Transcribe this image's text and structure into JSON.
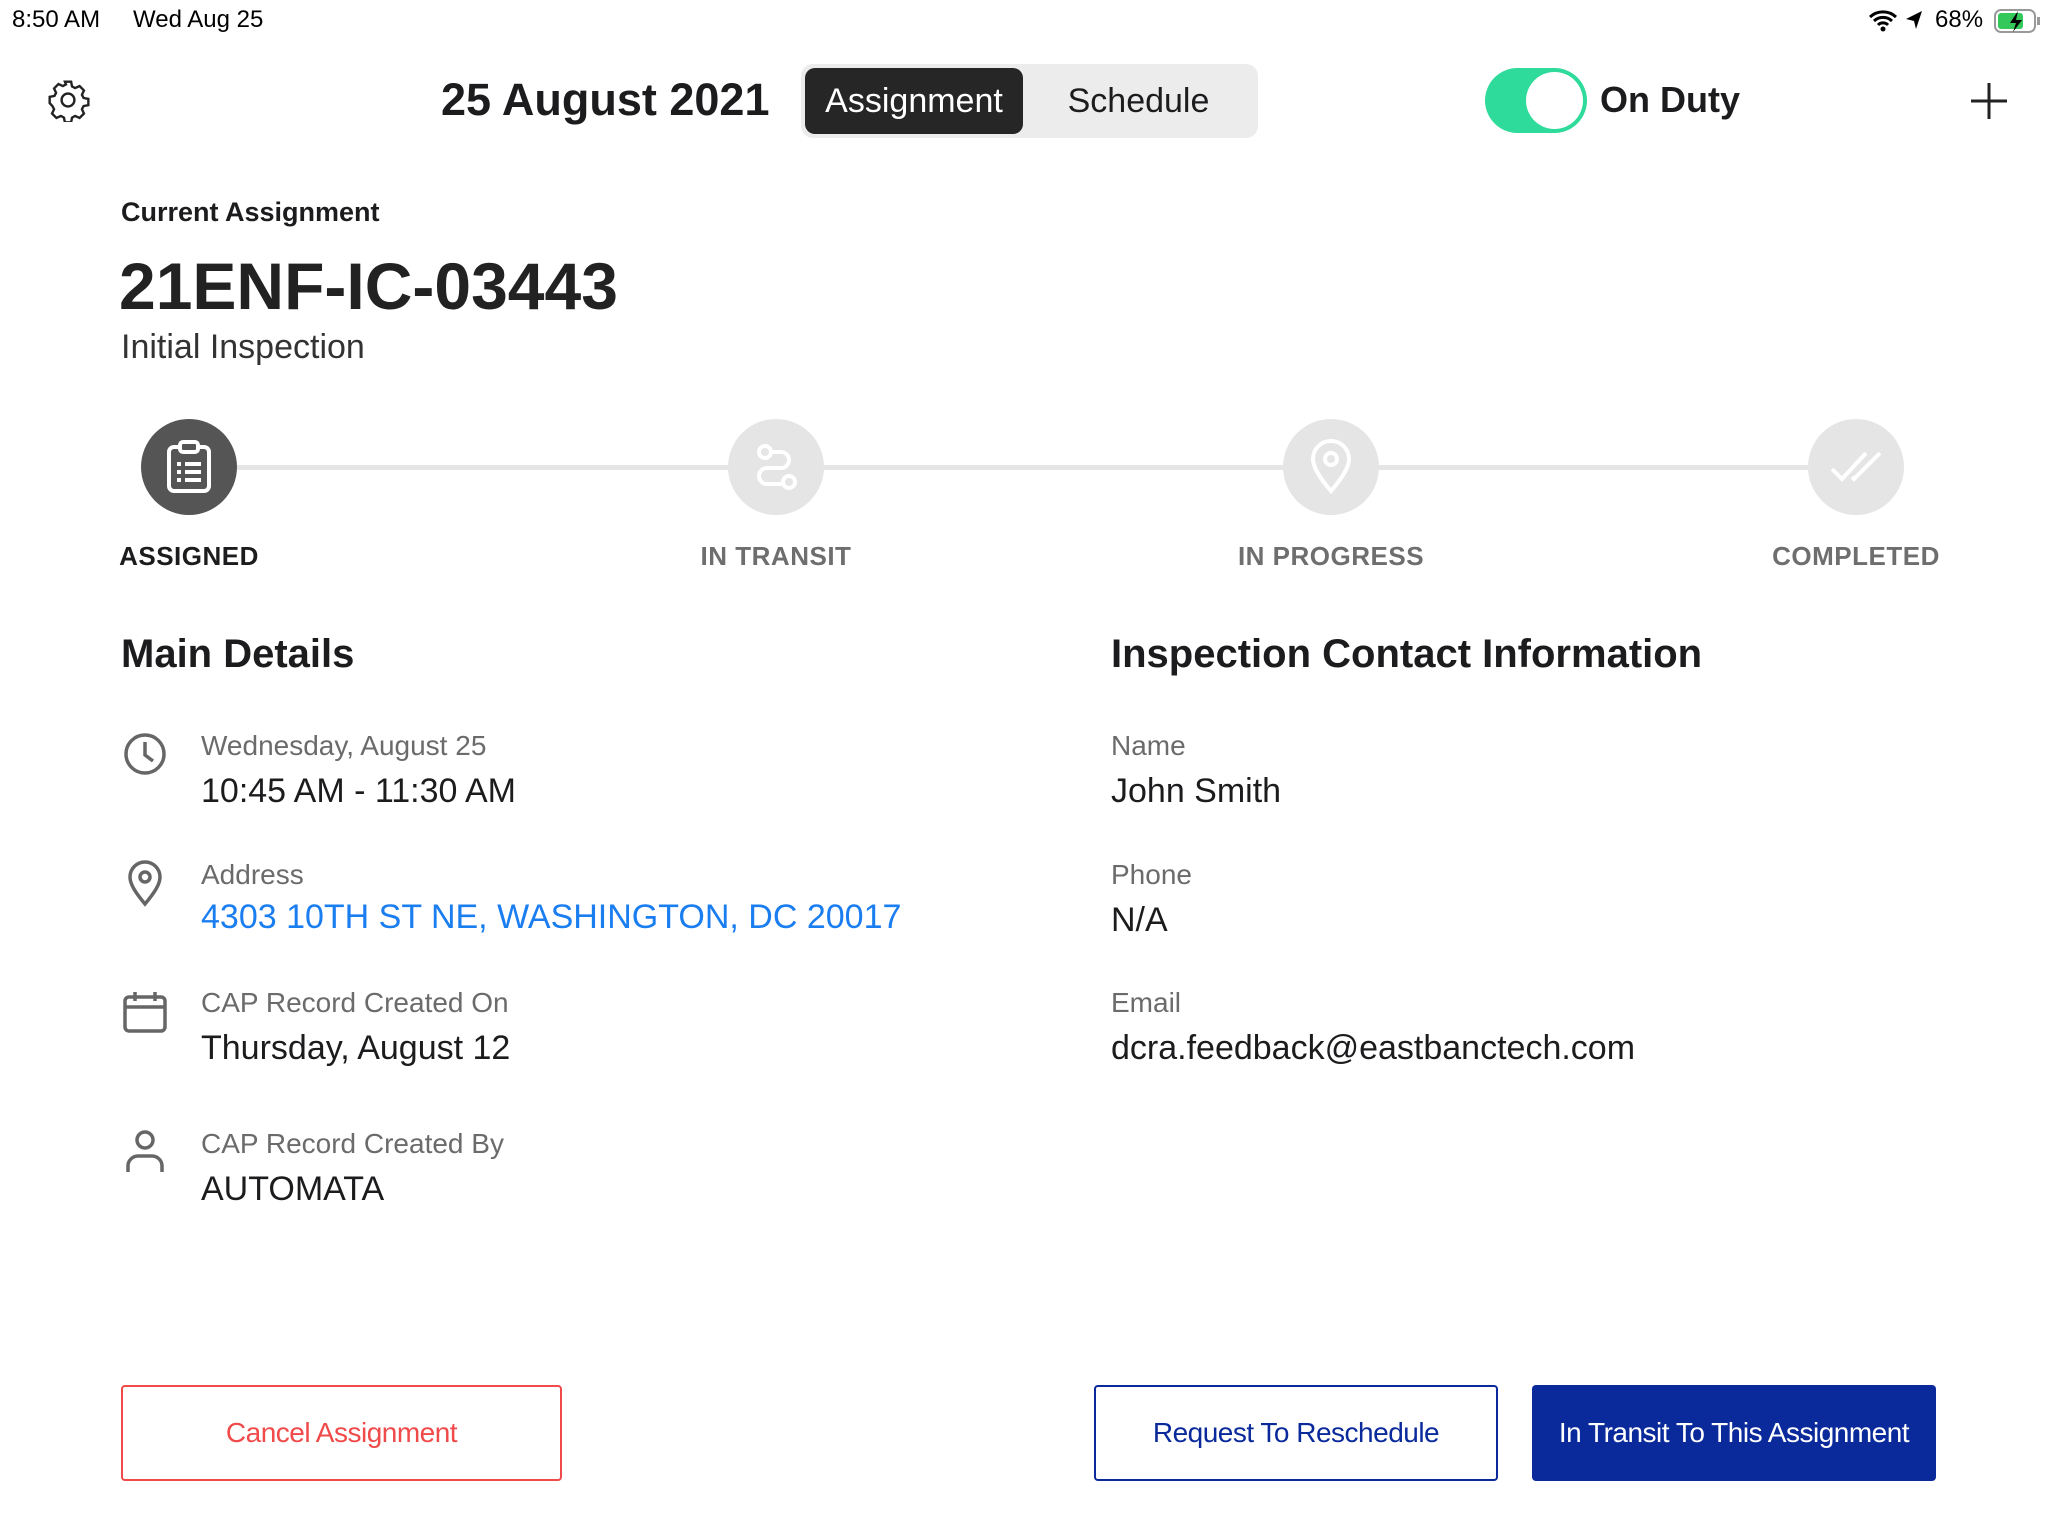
{
  "status_bar": {
    "time": "8:50 AM",
    "date": "Wed Aug 25",
    "battery": "68%",
    "icons": [
      "wifi-icon",
      "location-icon",
      "battery-charging-icon"
    ]
  },
  "header": {
    "date_title": "25 August 2021",
    "tabs": [
      {
        "label": "Assignment",
        "selected": true
      },
      {
        "label": "Schedule",
        "selected": false
      }
    ],
    "duty_label": "On Duty",
    "duty_on": true,
    "accent": "#2fdb9a"
  },
  "assignment": {
    "section_label": "Current Assignment",
    "id": "21ENF-IC-03443",
    "type": "Initial Inspection"
  },
  "steps": [
    {
      "label": "ASSIGNED",
      "icon": "clipboard-icon",
      "active": true
    },
    {
      "label": "IN TRANSIT",
      "icon": "route-icon",
      "active": false
    },
    {
      "label": "IN PROGRESS",
      "icon": "map-pin-icon",
      "active": false
    },
    {
      "label": "COMPLETED",
      "icon": "double-check-icon",
      "active": false
    }
  ],
  "main_details": {
    "title": "Main Details",
    "rows": [
      {
        "icon": "clock-icon",
        "label": "Wednesday, August 25",
        "value": "10:45 AM - 11:30 AM"
      },
      {
        "icon": "location-pin-icon",
        "label": "Address",
        "value": "4303 10TH ST NE, WASHINGTON, DC 20017"
      },
      {
        "icon": "calendar-icon",
        "label": "CAP Record Created On",
        "value": "Thursday, August 12"
      },
      {
        "icon": "person-icon",
        "label": "CAP Record Created By",
        "value": "AUTOMATA"
      }
    ]
  },
  "contact": {
    "title": "Inspection Contact Information",
    "rows": [
      {
        "label": "Name",
        "value": "John Smith"
      },
      {
        "label": "Phone",
        "value": "N/A"
      },
      {
        "label": "Email",
        "value": "dcra.feedback@eastbanctech.com"
      }
    ]
  },
  "actions": {
    "cancel": "Cancel Assignment",
    "reschedule": "Request To Reschedule",
    "transit": "In Transit To This Assignment",
    "danger_color": "#f04a4a",
    "primary_color": "#0a2a9c"
  }
}
